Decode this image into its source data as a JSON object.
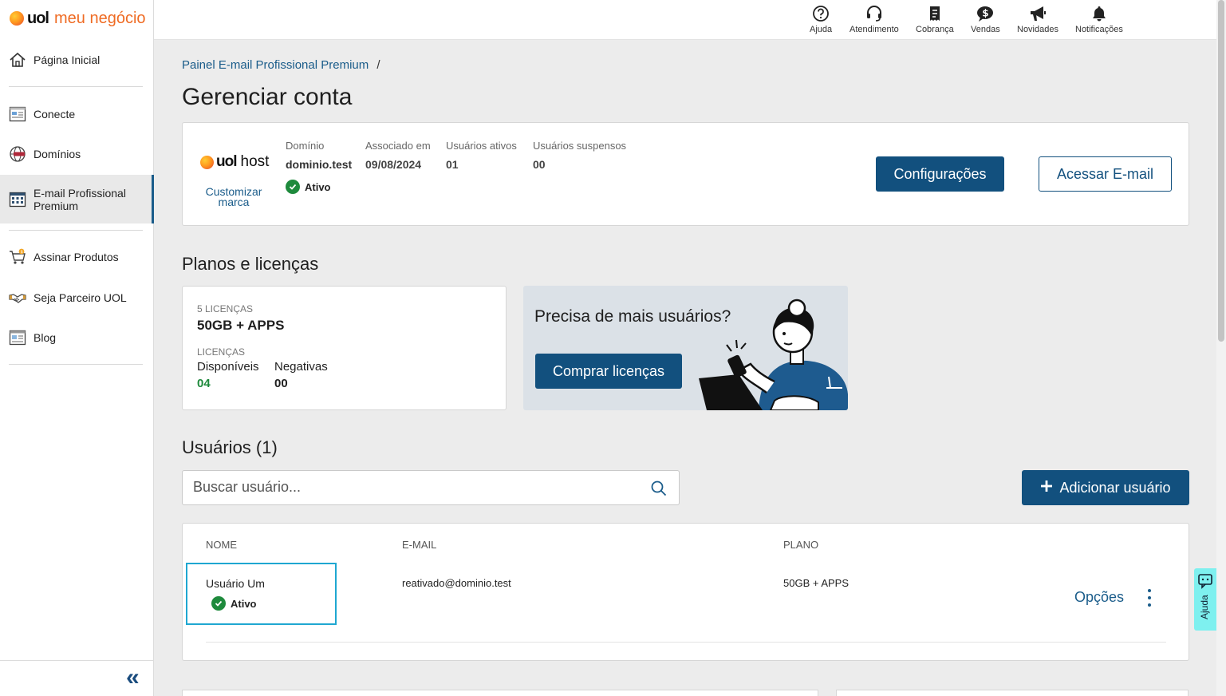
{
  "brand": {
    "logo_uol": "uol",
    "logo_rest": "meu negócio"
  },
  "sidebar": {
    "items": [
      {
        "label": "Página Inicial",
        "icon": "home-icon"
      },
      {
        "label": "Conecte",
        "icon": "conecte-icon"
      },
      {
        "label": "Domínios",
        "icon": "globe-www-icon"
      },
      {
        "label": "E-mail Profissional Premium",
        "icon": "email-grid-icon",
        "active": true
      },
      {
        "label": "Assinar Produtos",
        "icon": "cart-icon"
      },
      {
        "label": "Seja Parceiro UOL",
        "icon": "handshake-icon"
      },
      {
        "label": "Blog",
        "icon": "blog-icon"
      }
    ],
    "collapse_glyph": "«"
  },
  "topbar": {
    "items": [
      {
        "label": "Ajuda",
        "icon": "help-circle-icon"
      },
      {
        "label": "Atendimento",
        "icon": "headset-icon"
      },
      {
        "label": "Cobrança",
        "icon": "receipt-icon"
      },
      {
        "label": "Vendas",
        "icon": "dollar-chat-icon"
      },
      {
        "label": "Novidades",
        "icon": "megaphone-icon"
      },
      {
        "label": "Notificações",
        "icon": "bell-icon"
      }
    ]
  },
  "breadcrumb": {
    "link": "Painel E-mail Profissional Premium",
    "separator": "/"
  },
  "page_title": "Gerenciar conta",
  "account": {
    "host_logo_uol": "uol",
    "host_logo_rest": "host",
    "customize_label": "Customizar marca",
    "domain_label": "Domínio",
    "domain_value": "dominio.test",
    "status": "Ativo",
    "associated_label": "Associado em",
    "associated_value": "09/08/2024",
    "active_users_label": "Usuários ativos",
    "active_users_value": "01",
    "suspended_users_label": "Usuários suspensos",
    "suspended_users_value": "00",
    "settings_button": "Configurações",
    "access_button": "Acessar E-mail"
  },
  "plans": {
    "title": "Planos e licenças",
    "licenses_count": "5 LICENÇAS",
    "plan_name": "50GB + APPS",
    "licenses_label": "LICENÇAS",
    "available_label": "Disponíveis",
    "available_value": "04",
    "negative_label": "Negativas",
    "negative_value": "00",
    "promo_title": "Precisa de mais usuários?",
    "promo_button": "Comprar licenças"
  },
  "users": {
    "title": "Usuários (1)",
    "search_placeholder": "Buscar usuário...",
    "add_button": "Adicionar usuário",
    "columns": [
      "NOME",
      "E-MAIL",
      "PLANO"
    ],
    "rows": [
      {
        "name": "Usuário Um",
        "status": "Ativo",
        "email": "reativado@dominio.test",
        "plan": "50GB + APPS",
        "options": "Opções"
      }
    ]
  },
  "help_float": "Ajuda",
  "colors": {
    "primary": "#12507e",
    "link": "#1a5c8a",
    "success": "#1e8a3c",
    "highlight": "#1fa7d1",
    "help_float": "#7ef0ef",
    "brand_orange": "#ef6b23"
  }
}
